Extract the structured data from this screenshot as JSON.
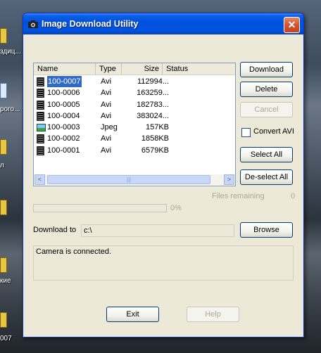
{
  "desktop": {
    "fragments": [
      "здиц...",
      "рого...",
      "л",
      "кие",
      "007"
    ]
  },
  "window": {
    "title": "Image Download Utility",
    "close_glyph": "✕"
  },
  "list": {
    "columns": [
      "Name",
      "Type",
      "Size",
      "Status"
    ],
    "rows": [
      {
        "name": "100-0007",
        "type": "Avi",
        "size": "112994...",
        "status": "",
        "icon": "video-file-icon",
        "selected": true
      },
      {
        "name": "100-0006",
        "type": "Avi",
        "size": "163259...",
        "status": "",
        "icon": "video-file-icon",
        "selected": false
      },
      {
        "name": "100-0005",
        "type": "Avi",
        "size": "182783...",
        "status": "",
        "icon": "video-file-icon",
        "selected": false
      },
      {
        "name": "100-0004",
        "type": "Avi",
        "size": "383024...",
        "status": "",
        "icon": "video-file-icon",
        "selected": false
      },
      {
        "name": "100-0003",
        "type": "Jpeg",
        "size": "157KB",
        "status": "",
        "icon": "image-file-icon",
        "selected": false
      },
      {
        "name": "100-0002",
        "type": "Avi",
        "size": "1858KB",
        "status": "",
        "icon": "video-file-icon",
        "selected": false
      },
      {
        "name": "100-0001",
        "type": "Avi",
        "size": "6579KB",
        "status": "",
        "icon": "video-file-icon",
        "selected": false
      }
    ],
    "scroll_left": "<",
    "scroll_right": ">",
    "scroll_grip": "|||"
  },
  "buttons": {
    "download": "Download",
    "delete": "Delete",
    "cancel": "Cancel",
    "convert_avi": "Convert AVI",
    "select_all": "Select All",
    "deselect_all": "De-select All",
    "browse": "Browse",
    "exit": "Exit",
    "help": "Help"
  },
  "progress": {
    "files_remaining_label": "Files remaining",
    "files_remaining_value": "0",
    "percent_text": "0%",
    "fraction": 0
  },
  "download": {
    "label": "Download to",
    "path": "c:\\"
  },
  "status": {
    "message": "Camera is connected."
  },
  "colors": {
    "titlebar": "#0052de",
    "selection": "#316ac5",
    "close_button": "#d6532e"
  }
}
